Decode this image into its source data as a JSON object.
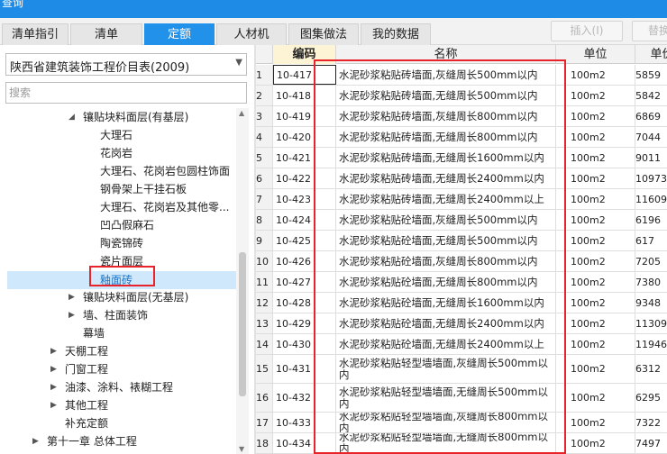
{
  "window": {
    "title": "查询"
  },
  "tabs": [
    {
      "label": "清单指引",
      "active": false
    },
    {
      "label": "清单",
      "active": false
    },
    {
      "label": "定额",
      "active": true
    },
    {
      "label": "人材机",
      "active": false
    },
    {
      "label": "图集做法",
      "active": false
    },
    {
      "label": "我的数据",
      "active": false
    }
  ],
  "toolbar": {
    "insert_label": "插入(I)",
    "replace_label": "替换"
  },
  "library_select": {
    "value": "陕西省建筑装饰工程价目表(2009)"
  },
  "search": {
    "placeholder": "搜索",
    "value": ""
  },
  "tree": [
    {
      "label": "镶贴块料面层(有基层)",
      "expanded": true,
      "selected": false
    },
    {
      "label": "大理石",
      "selected": false
    },
    {
      "label": "花岗岩",
      "selected": false
    },
    {
      "label": "大理石、花岗岩包圆柱饰面",
      "selected": false
    },
    {
      "label": "钢骨架上干挂石板",
      "selected": false
    },
    {
      "label": "大理石、花岗岩及其他零...",
      "selected": false
    },
    {
      "label": "凹凸假麻石",
      "selected": false
    },
    {
      "label": "陶瓷锦砖",
      "selected": false
    },
    {
      "label": "瓷片面层",
      "selected": false
    },
    {
      "label": "釉面砖",
      "selected": true
    },
    {
      "label": "镶贴块料面层(无基层)",
      "expanded": false,
      "selected": false
    },
    {
      "label": "墙、柱面装饰",
      "expanded": false,
      "selected": false
    },
    {
      "label": "幕墙",
      "selected": false
    },
    {
      "label": "天棚工程",
      "expanded": false,
      "selected": false
    },
    {
      "label": "门窗工程",
      "expanded": false,
      "selected": false
    },
    {
      "label": "油漆、涂料、裱糊工程",
      "expanded": false,
      "selected": false
    },
    {
      "label": "其他工程",
      "expanded": false,
      "selected": false
    },
    {
      "label": "补充定额",
      "selected": false
    },
    {
      "label": "第十一章 总体工程",
      "expanded": false,
      "selected": false
    }
  ],
  "grid": {
    "columns": {
      "code": "编码",
      "name": "名称",
      "unit": "单位",
      "price": "单价"
    },
    "rows": [
      {
        "num": "1",
        "code": "10-417",
        "name": "水泥砂浆粘贴砖墙面,灰缝周长500mm以内",
        "unit": "100m2",
        "price": "5859"
      },
      {
        "num": "2",
        "code": "10-418",
        "name": "水泥砂浆粘贴砖墙面,无缝周长500mm以内",
        "unit": "100m2",
        "price": "5842"
      },
      {
        "num": "3",
        "code": "10-419",
        "name": "水泥砂浆粘贴砖墙面,灰缝周长800mm以内",
        "unit": "100m2",
        "price": "6869"
      },
      {
        "num": "4",
        "code": "10-420",
        "name": "水泥砂浆粘贴砖墙面,无缝周长800mm以内",
        "unit": "100m2",
        "price": "7044"
      },
      {
        "num": "5",
        "code": "10-421",
        "name": "水泥砂浆粘贴砖墙面,无缝周长1600mm以内",
        "unit": "100m2",
        "price": "9011"
      },
      {
        "num": "6",
        "code": "10-422",
        "name": "水泥砂浆粘贴砖墙面,无缝周长2400mm以内",
        "unit": "100m2",
        "price": "10973"
      },
      {
        "num": "7",
        "code": "10-423",
        "name": "水泥砂浆粘贴砖墙面,无缝周长2400mm以上",
        "unit": "100m2",
        "price": "11609"
      },
      {
        "num": "8",
        "code": "10-424",
        "name": "水泥砂浆粘贴砼墙面,灰缝周长500mm以内",
        "unit": "100m2",
        "price": "6196"
      },
      {
        "num": "9",
        "code": "10-425",
        "name": "水泥砂浆粘贴砼墙面,无缝周长500mm以内",
        "unit": "100m2",
        "price": "617"
      },
      {
        "num": "10",
        "code": "10-426",
        "name": "水泥砂浆粘贴砼墙面,灰缝周长800mm以内",
        "unit": "100m2",
        "price": "7205"
      },
      {
        "num": "11",
        "code": "10-427",
        "name": "水泥砂浆粘贴砼墙面,无缝周长800mm以内",
        "unit": "100m2",
        "price": "7380"
      },
      {
        "num": "12",
        "code": "10-428",
        "name": "水泥砂浆粘贴砼墙面,无缝周长1600mm以内",
        "unit": "100m2",
        "price": "9348"
      },
      {
        "num": "13",
        "code": "10-429",
        "name": "水泥砂浆粘贴砼墙面,无缝周长2400mm以内",
        "unit": "100m2",
        "price": "11309"
      },
      {
        "num": "14",
        "code": "10-430",
        "name": "水泥砂浆粘贴砼墙面,无缝周长2400mm以上",
        "unit": "100m2",
        "price": "11946"
      },
      {
        "num": "15",
        "code": "10-431",
        "name": "水泥砂浆粘贴轻型墙墙面,灰缝周长500mm以内",
        "unit": "100m2",
        "price": "6312"
      },
      {
        "num": "16",
        "code": "10-432",
        "name": "水泥砂浆粘贴轻型墙墙面,无缝周长500mm以内",
        "unit": "100m2",
        "price": "6295"
      },
      {
        "num": "17",
        "code": "10-433",
        "name": "水泥砂浆粘贴轻型墙墙面,灰缝周长800mm以内",
        "unit": "100m2",
        "price": "7322"
      },
      {
        "num": "18",
        "code": "10-434",
        "name": "水泥砂浆粘贴轻型墙墙面,无缝周长800mm以内",
        "unit": "100m2",
        "price": "7497"
      }
    ]
  },
  "colors": {
    "accent": "#2291ea",
    "highlight_box": "#e8232a",
    "code_header_bg": "#fdf3d5"
  }
}
